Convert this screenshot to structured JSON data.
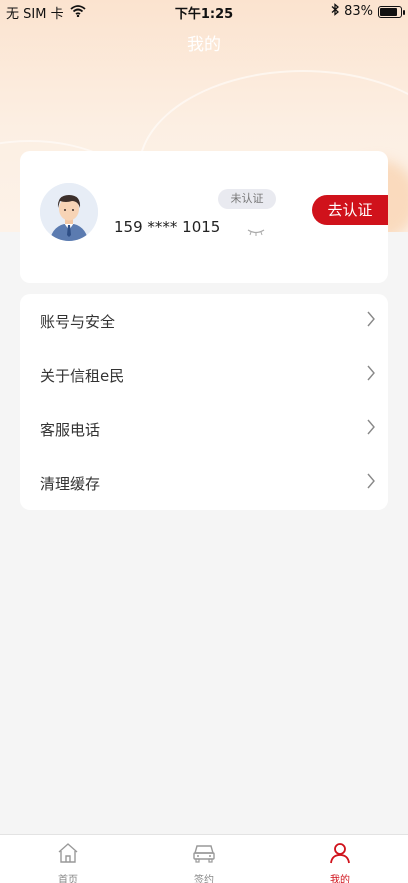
{
  "status_bar": {
    "carrier": "无 SIM 卡",
    "time": "下午1:25",
    "battery": "83%",
    "battery_level": 0.83
  },
  "header": {
    "title": "我的"
  },
  "profile": {
    "phone": "159 **** 1015",
    "status_badge": "未认证",
    "verify_button": "去认证"
  },
  "menu": {
    "items": [
      {
        "label": "账号与安全"
      },
      {
        "label": "关于信租e民"
      },
      {
        "label": "客服电话"
      },
      {
        "label": "清理缓存"
      }
    ]
  },
  "tabbar": {
    "tabs": [
      {
        "label": "首页",
        "icon": "home-icon"
      },
      {
        "label": "签约",
        "icon": "car-icon"
      },
      {
        "label": "我的",
        "icon": "person-icon",
        "active": true
      }
    ]
  },
  "colors": {
    "accent": "#d0121b",
    "hero_gradient_top": "#fbe3cf",
    "background": "#f5f5f5"
  }
}
